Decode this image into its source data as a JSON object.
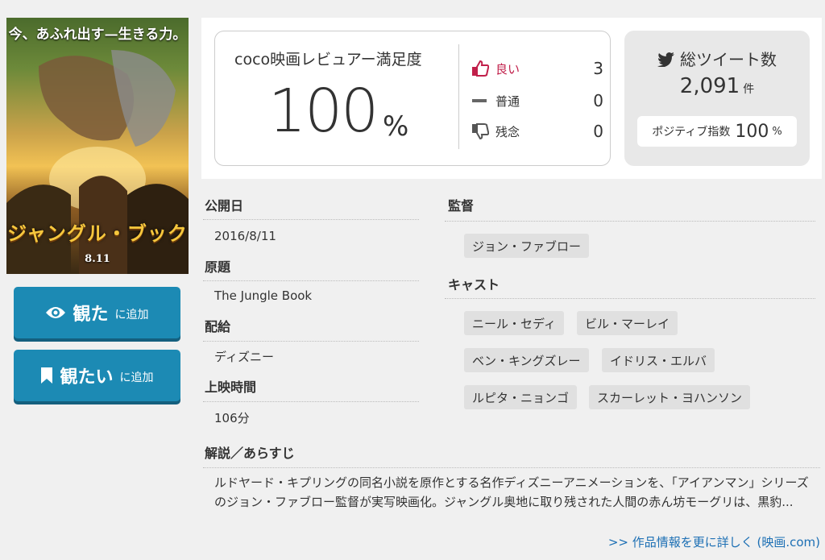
{
  "poster": {
    "tagline": "今、あふれ出す—生きる力。",
    "title": "ジャングル・ブック",
    "date": "8.11"
  },
  "buttons": {
    "seen": {
      "big": "観た",
      "small": "に追加"
    },
    "want": {
      "big": "観たい",
      "small": "に追加"
    }
  },
  "rating": {
    "label": "coco映画レビュアー満足度",
    "value": "100",
    "unit": "%",
    "votes": [
      {
        "label": "良い",
        "count": "3"
      },
      {
        "label": "普通",
        "count": "0"
      },
      {
        "label": "残念",
        "count": "0"
      }
    ]
  },
  "tweets": {
    "title": "総ツイート数",
    "count": "2,091",
    "unit": "件",
    "positive_label": "ポジティブ指数",
    "positive_value": "100",
    "positive_unit": "%"
  },
  "info": {
    "release_label": "公開日",
    "release_value": "2016/8/11",
    "original_label": "原題",
    "original_value": "The Jungle Book",
    "distributor_label": "配給",
    "distributor_value": "ディズニー",
    "runtime_label": "上映時間",
    "runtime_value": "106分",
    "director_label": "監督",
    "director": "ジョン・ファブロー",
    "cast_label": "キャスト",
    "cast": [
      "ニール・セディ",
      "ビル・マーレイ",
      "ベン・キングズレー",
      "イドリス・エルバ",
      "ルピタ・ニョンゴ",
      "スカーレット・ヨハンソン"
    ],
    "synopsis_label": "解説／あらすじ",
    "synopsis": "ルドヤード・キプリングの同名小説を原作とする名作ディズニーアニメーションを、「アイアンマン」シリーズのジョン・ファブロー監督が実写映画化。ジャングル奥地に取り残された人間の赤ん坊モーグリは、黒豹...",
    "more_link": ">> 作品情報を更に詳しく (映画.com)"
  },
  "colors": {
    "button": "#1c8ab4",
    "good": "#c11f4a",
    "link": "#1c6fb4"
  }
}
